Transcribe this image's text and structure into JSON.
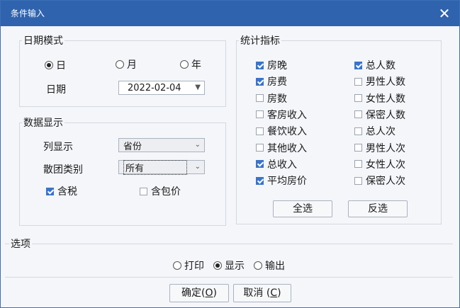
{
  "window": {
    "title": "条件输入",
    "close_glyph": "✕"
  },
  "date_mode": {
    "title": "日期模式",
    "options": [
      {
        "label": "日",
        "selected": true
      },
      {
        "label": "月",
        "selected": false
      },
      {
        "label": "年",
        "selected": false
      }
    ],
    "date_label": "日期",
    "date_value": "2022-02-04"
  },
  "data_display": {
    "title": "数据显示",
    "column_label": "列显示",
    "column_value": "省份",
    "group_label": "散团类别",
    "group_value": "所有",
    "tax_label": "含税",
    "tax_checked": true,
    "package_label": "含包价",
    "package_checked": false
  },
  "stats": {
    "title": "统计指标",
    "left": [
      {
        "label": "房晚",
        "checked": true
      },
      {
        "label": "房费",
        "checked": true
      },
      {
        "label": "房数",
        "checked": false
      },
      {
        "label": "客房收入",
        "checked": false
      },
      {
        "label": "餐饮收入",
        "checked": false
      },
      {
        "label": "其他收入",
        "checked": false
      },
      {
        "label": "总收入",
        "checked": true
      },
      {
        "label": "平均房价",
        "checked": true
      }
    ],
    "right": [
      {
        "label": "总人数",
        "checked": true
      },
      {
        "label": "男性人数",
        "checked": false
      },
      {
        "label": "女性人数",
        "checked": false
      },
      {
        "label": "保密人数",
        "checked": false
      },
      {
        "label": "总人次",
        "checked": false
      },
      {
        "label": "男性人次",
        "checked": false
      },
      {
        "label": "女性人次",
        "checked": false
      },
      {
        "label": "保密人次",
        "checked": false
      }
    ],
    "select_all": "全选",
    "invert": "反选"
  },
  "options": {
    "title": "选项",
    "items": [
      {
        "label": "打印",
        "selected": false
      },
      {
        "label": "显示",
        "selected": true
      },
      {
        "label": "输出",
        "selected": false
      }
    ]
  },
  "footer": {
    "ok_label": "确定(",
    "ok_key": "O",
    "ok_close": ")",
    "cancel_label": "取消 (",
    "cancel_key": "C",
    "cancel_close": ")"
  },
  "colors": {
    "titlebar": "#2f63ad",
    "check_accent": "#3a74c9"
  }
}
